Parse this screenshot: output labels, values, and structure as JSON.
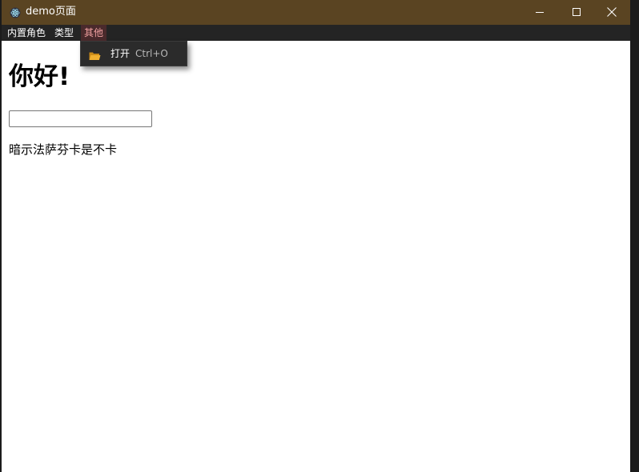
{
  "window": {
    "title": "demo页面",
    "icon": "electron-atom-icon"
  },
  "title_bar_controls": {
    "minimize_icon": "minimize-icon",
    "maximize_icon": "maximize-icon",
    "close_icon": "close-icon"
  },
  "menubar": {
    "items": [
      {
        "label": "内置角色",
        "active": false
      },
      {
        "label": "类型",
        "active": false
      },
      {
        "label": "其他",
        "active": true
      }
    ]
  },
  "dropdown": {
    "items": [
      {
        "label": "打开",
        "shortcut": "Ctrl+O",
        "icon": "folder-open-icon"
      }
    ]
  },
  "content": {
    "heading": "你好!",
    "input": {
      "value": "",
      "placeholder": ""
    },
    "paragraph": "暗示法萨芬卡是不卡"
  },
  "colors": {
    "titlebar_bg": "#5a4422",
    "menubar_bg": "#242424",
    "active_menu_bg": "#4a2a2c",
    "active_menu_text": "#f0a0a0",
    "dropdown_bg": "#2b2b2b",
    "folder_icon": "#f0b030"
  }
}
